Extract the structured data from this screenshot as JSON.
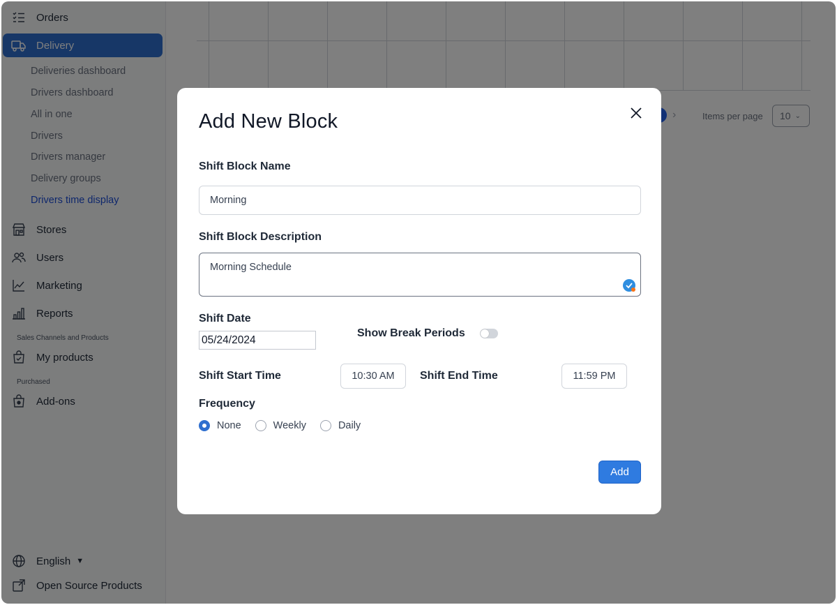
{
  "sidebar": {
    "top_items": [
      {
        "label": "Orders",
        "icon": "list-icon"
      },
      {
        "label": "Delivery",
        "icon": "truck-icon"
      }
    ],
    "delivery_sub_items": [
      "Deliveries dashboard",
      "Drivers dashboard",
      "All in one",
      "Drivers",
      "Drivers manager",
      "Delivery groups",
      "Drivers time display"
    ],
    "main_items": [
      {
        "label": "Stores",
        "icon": "store-icon"
      },
      {
        "label": "Users",
        "icon": "users-icon"
      },
      {
        "label": "Marketing",
        "icon": "chart-line-icon"
      },
      {
        "label": "Reports",
        "icon": "bar-chart-icon"
      }
    ],
    "section_sales": "Sales Channels and Products",
    "my_products": "My products",
    "section_purchased": "Purchased",
    "addons": "Add-ons",
    "language": "English",
    "open_source": "Open Source Products"
  },
  "background": {
    "items_per_page_label": "Items per page",
    "items_per_page_value": "10"
  },
  "modal": {
    "title": "Add New Block",
    "name_label": "Shift Block Name",
    "name_value": "Morning",
    "description_label": "Shift Block Description",
    "description_value": "Morning Schedule",
    "date_label": "Shift Date",
    "date_value": "05/24/2024",
    "break_label": "Show Break Periods",
    "break_enabled": false,
    "start_label": "Shift Start Time",
    "start_value": "10:30 AM",
    "end_label": "Shift End Time",
    "end_value": "11:59 PM",
    "frequency_label": "Frequency",
    "frequency_options": [
      "None",
      "Weekly",
      "Daily"
    ],
    "frequency_selected": "None",
    "add_label": "Add"
  },
  "colors": {
    "accent": "#2f6fcf",
    "overlay": "#000000",
    "button": "#2f7be0"
  }
}
